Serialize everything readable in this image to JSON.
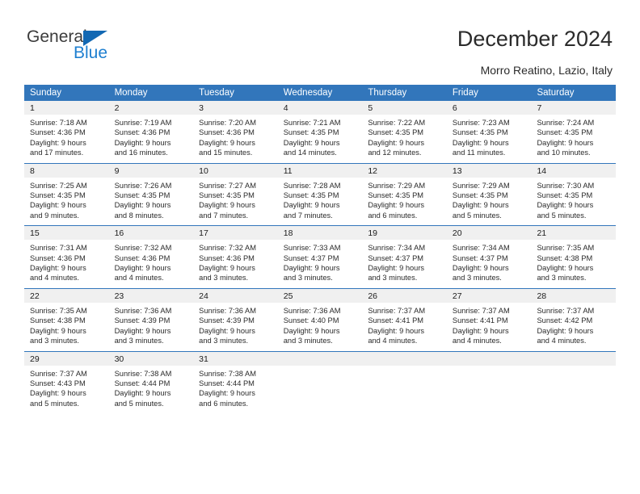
{
  "brand": {
    "name_part1": "General",
    "name_part2": "Blue",
    "logo_icon": "blue-triangle-logo"
  },
  "header": {
    "title": "December 2024",
    "location": "Morro Reatino, Lazio, Italy"
  },
  "theme": {
    "header_blue": "#3276bb",
    "daynum_background": "#f0f0f0",
    "brand_blue": "#1e7fd0",
    "text": "#2a2a2a"
  },
  "calendar": {
    "weekday_headers": [
      "Sunday",
      "Monday",
      "Tuesday",
      "Wednesday",
      "Thursday",
      "Friday",
      "Saturday"
    ],
    "weeks": [
      [
        {
          "day": "1",
          "sunrise": "Sunrise: 7:18 AM",
          "sunset": "Sunset: 4:36 PM",
          "daylight1": "Daylight: 9 hours",
          "daylight2": "and 17 minutes."
        },
        {
          "day": "2",
          "sunrise": "Sunrise: 7:19 AM",
          "sunset": "Sunset: 4:36 PM",
          "daylight1": "Daylight: 9 hours",
          "daylight2": "and 16 minutes."
        },
        {
          "day": "3",
          "sunrise": "Sunrise: 7:20 AM",
          "sunset": "Sunset: 4:36 PM",
          "daylight1": "Daylight: 9 hours",
          "daylight2": "and 15 minutes."
        },
        {
          "day": "4",
          "sunrise": "Sunrise: 7:21 AM",
          "sunset": "Sunset: 4:35 PM",
          "daylight1": "Daylight: 9 hours",
          "daylight2": "and 14 minutes."
        },
        {
          "day": "5",
          "sunrise": "Sunrise: 7:22 AM",
          "sunset": "Sunset: 4:35 PM",
          "daylight1": "Daylight: 9 hours",
          "daylight2": "and 12 minutes."
        },
        {
          "day": "6",
          "sunrise": "Sunrise: 7:23 AM",
          "sunset": "Sunset: 4:35 PM",
          "daylight1": "Daylight: 9 hours",
          "daylight2": "and 11 minutes."
        },
        {
          "day": "7",
          "sunrise": "Sunrise: 7:24 AM",
          "sunset": "Sunset: 4:35 PM",
          "daylight1": "Daylight: 9 hours",
          "daylight2": "and 10 minutes."
        }
      ],
      [
        {
          "day": "8",
          "sunrise": "Sunrise: 7:25 AM",
          "sunset": "Sunset: 4:35 PM",
          "daylight1": "Daylight: 9 hours",
          "daylight2": "and 9 minutes."
        },
        {
          "day": "9",
          "sunrise": "Sunrise: 7:26 AM",
          "sunset": "Sunset: 4:35 PM",
          "daylight1": "Daylight: 9 hours",
          "daylight2": "and 8 minutes."
        },
        {
          "day": "10",
          "sunrise": "Sunrise: 7:27 AM",
          "sunset": "Sunset: 4:35 PM",
          "daylight1": "Daylight: 9 hours",
          "daylight2": "and 7 minutes."
        },
        {
          "day": "11",
          "sunrise": "Sunrise: 7:28 AM",
          "sunset": "Sunset: 4:35 PM",
          "daylight1": "Daylight: 9 hours",
          "daylight2": "and 7 minutes."
        },
        {
          "day": "12",
          "sunrise": "Sunrise: 7:29 AM",
          "sunset": "Sunset: 4:35 PM",
          "daylight1": "Daylight: 9 hours",
          "daylight2": "and 6 minutes."
        },
        {
          "day": "13",
          "sunrise": "Sunrise: 7:29 AM",
          "sunset": "Sunset: 4:35 PM",
          "daylight1": "Daylight: 9 hours",
          "daylight2": "and 5 minutes."
        },
        {
          "day": "14",
          "sunrise": "Sunrise: 7:30 AM",
          "sunset": "Sunset: 4:35 PM",
          "daylight1": "Daylight: 9 hours",
          "daylight2": "and 5 minutes."
        }
      ],
      [
        {
          "day": "15",
          "sunrise": "Sunrise: 7:31 AM",
          "sunset": "Sunset: 4:36 PM",
          "daylight1": "Daylight: 9 hours",
          "daylight2": "and 4 minutes."
        },
        {
          "day": "16",
          "sunrise": "Sunrise: 7:32 AM",
          "sunset": "Sunset: 4:36 PM",
          "daylight1": "Daylight: 9 hours",
          "daylight2": "and 4 minutes."
        },
        {
          "day": "17",
          "sunrise": "Sunrise: 7:32 AM",
          "sunset": "Sunset: 4:36 PM",
          "daylight1": "Daylight: 9 hours",
          "daylight2": "and 3 minutes."
        },
        {
          "day": "18",
          "sunrise": "Sunrise: 7:33 AM",
          "sunset": "Sunset: 4:37 PM",
          "daylight1": "Daylight: 9 hours",
          "daylight2": "and 3 minutes."
        },
        {
          "day": "19",
          "sunrise": "Sunrise: 7:34 AM",
          "sunset": "Sunset: 4:37 PM",
          "daylight1": "Daylight: 9 hours",
          "daylight2": "and 3 minutes."
        },
        {
          "day": "20",
          "sunrise": "Sunrise: 7:34 AM",
          "sunset": "Sunset: 4:37 PM",
          "daylight1": "Daylight: 9 hours",
          "daylight2": "and 3 minutes."
        },
        {
          "day": "21",
          "sunrise": "Sunrise: 7:35 AM",
          "sunset": "Sunset: 4:38 PM",
          "daylight1": "Daylight: 9 hours",
          "daylight2": "and 3 minutes."
        }
      ],
      [
        {
          "day": "22",
          "sunrise": "Sunrise: 7:35 AM",
          "sunset": "Sunset: 4:38 PM",
          "daylight1": "Daylight: 9 hours",
          "daylight2": "and 3 minutes."
        },
        {
          "day": "23",
          "sunrise": "Sunrise: 7:36 AM",
          "sunset": "Sunset: 4:39 PM",
          "daylight1": "Daylight: 9 hours",
          "daylight2": "and 3 minutes."
        },
        {
          "day": "24",
          "sunrise": "Sunrise: 7:36 AM",
          "sunset": "Sunset: 4:39 PM",
          "daylight1": "Daylight: 9 hours",
          "daylight2": "and 3 minutes."
        },
        {
          "day": "25",
          "sunrise": "Sunrise: 7:36 AM",
          "sunset": "Sunset: 4:40 PM",
          "daylight1": "Daylight: 9 hours",
          "daylight2": "and 3 minutes."
        },
        {
          "day": "26",
          "sunrise": "Sunrise: 7:37 AM",
          "sunset": "Sunset: 4:41 PM",
          "daylight1": "Daylight: 9 hours",
          "daylight2": "and 4 minutes."
        },
        {
          "day": "27",
          "sunrise": "Sunrise: 7:37 AM",
          "sunset": "Sunset: 4:41 PM",
          "daylight1": "Daylight: 9 hours",
          "daylight2": "and 4 minutes."
        },
        {
          "day": "28",
          "sunrise": "Sunrise: 7:37 AM",
          "sunset": "Sunset: 4:42 PM",
          "daylight1": "Daylight: 9 hours",
          "daylight2": "and 4 minutes."
        }
      ],
      [
        {
          "day": "29",
          "sunrise": "Sunrise: 7:37 AM",
          "sunset": "Sunset: 4:43 PM",
          "daylight1": "Daylight: 9 hours",
          "daylight2": "and 5 minutes."
        },
        {
          "day": "30",
          "sunrise": "Sunrise: 7:38 AM",
          "sunset": "Sunset: 4:44 PM",
          "daylight1": "Daylight: 9 hours",
          "daylight2": "and 5 minutes."
        },
        {
          "day": "31",
          "sunrise": "Sunrise: 7:38 AM",
          "sunset": "Sunset: 4:44 PM",
          "daylight1": "Daylight: 9 hours",
          "daylight2": "and 6 minutes."
        },
        {
          "day": "",
          "sunrise": "",
          "sunset": "",
          "daylight1": "",
          "daylight2": ""
        },
        {
          "day": "",
          "sunrise": "",
          "sunset": "",
          "daylight1": "",
          "daylight2": ""
        },
        {
          "day": "",
          "sunrise": "",
          "sunset": "",
          "daylight1": "",
          "daylight2": ""
        },
        {
          "day": "",
          "sunrise": "",
          "sunset": "",
          "daylight1": "",
          "daylight2": ""
        }
      ]
    ]
  }
}
